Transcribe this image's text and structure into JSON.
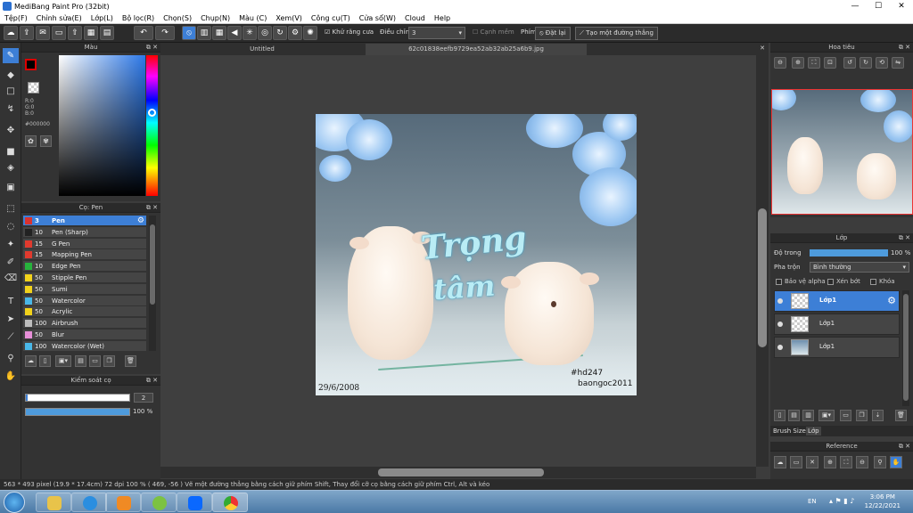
{
  "window": {
    "title": "MediBang Paint Pro (32bit)",
    "min_label": "—",
    "max_label": "☐",
    "close_label": "✕"
  },
  "menu": [
    "Tệp(F)",
    "Chỉnh sửa(E)",
    "Lớp(L)",
    "Bộ lọc(R)",
    "Chọn(S)",
    "Chụp(N)",
    "Màu (C)",
    "Xem(V)",
    "Công cụ(T)",
    "Cửa sổ(W)",
    "Cloud",
    "Help"
  ],
  "toolbar": {
    "antialias_label": "Khử răng cưa",
    "adjust_label": "Điều chỉnh",
    "adjust_value": "3",
    "edge_label": "Cạnh mềm",
    "key_label": "Phím",
    "reset_label": "Đặt lại",
    "straight_line_label": "Tạo một đường thẳng"
  },
  "color_panel": {
    "title": "Màu",
    "r": "R:0",
    "g": "G:0",
    "b": "B:0",
    "hex": "#000000"
  },
  "brush_panel": {
    "title": "Cọ: Pen",
    "items": [
      {
        "size": "3",
        "name": "Pen",
        "color": "#d9322f",
        "selected": true
      },
      {
        "size": "10",
        "name": "Pen (Sharp)",
        "color": "#222222",
        "selected": false
      },
      {
        "size": "15",
        "name": "G Pen",
        "color": "#e03a2e",
        "selected": false
      },
      {
        "size": "15",
        "name": "Mapping Pen",
        "color": "#e03a2e",
        "selected": false
      },
      {
        "size": "10",
        "name": "Edge Pen",
        "color": "#27b33c",
        "selected": false
      },
      {
        "size": "50",
        "name": "Stipple Pen",
        "color": "#f2d21b",
        "selected": false
      },
      {
        "size": "50",
        "name": "Sumi",
        "color": "#f2d21b",
        "selected": false
      },
      {
        "size": "50",
        "name": "Watercolor",
        "color": "#49b7e8",
        "selected": false
      },
      {
        "size": "50",
        "name": "Acrylic",
        "color": "#f2d21b",
        "selected": false
      },
      {
        "size": "100",
        "name": "Airbrush",
        "color": "#bdbdbd",
        "selected": false
      },
      {
        "size": "50",
        "name": "Blur",
        "color": "#e78fd8",
        "selected": false
      },
      {
        "size": "100",
        "name": "Watercolor (Wet)",
        "color": "#49b7e8",
        "selected": false
      }
    ]
  },
  "brush_control": {
    "title": "Kiểm soát cọ",
    "size_value": "2",
    "opacity_value": "100 %",
    "opacity_fraction": 1.0
  },
  "tabs": [
    {
      "label": "Untitled"
    },
    {
      "label": "62c01838eefb9729ea52ab32ab25a6b9.jpg"
    }
  ],
  "artwork": {
    "lettering_1": "Trọng",
    "lettering_2": "tâm",
    "tag": "#hd247",
    "author": "baongoc2011",
    "date": "29/6/2008"
  },
  "navigator": {
    "title": "Hoa tiêu"
  },
  "layer_panel": {
    "title": "Lớp",
    "opacity_label": "Độ trong",
    "opacity_value": "100 %",
    "opacity_fraction": 1.0,
    "blend_label": "Pha trộn",
    "blend_value": "Bình thường",
    "protect_alpha": "Bảo vệ alpha",
    "clipping": "Xén bớt",
    "lock": "Khóa",
    "layers": [
      {
        "name": "Lớp1",
        "selected": true
      },
      {
        "name": "Lớp1",
        "selected": false
      },
      {
        "name": "Lớp1",
        "selected": false
      }
    ],
    "tab_brush_size": "Brush Size",
    "tab_layer": "Lớp"
  },
  "reference_panel": {
    "title": "Reference"
  },
  "status": {
    "text": "563 * 493 pixel   (19.9 * 17.4cm)   72 dpi   100 %   ( 469, -56 )   Vẽ một đường thẳng bằng cách giữ phím Shift, Thay đổi cỡ cọ bằng cách giữ phím Ctrl, Alt và kéo"
  },
  "taskbar": {
    "lang": "EN",
    "time": "3:06 PM",
    "date": "12/22/2021"
  }
}
